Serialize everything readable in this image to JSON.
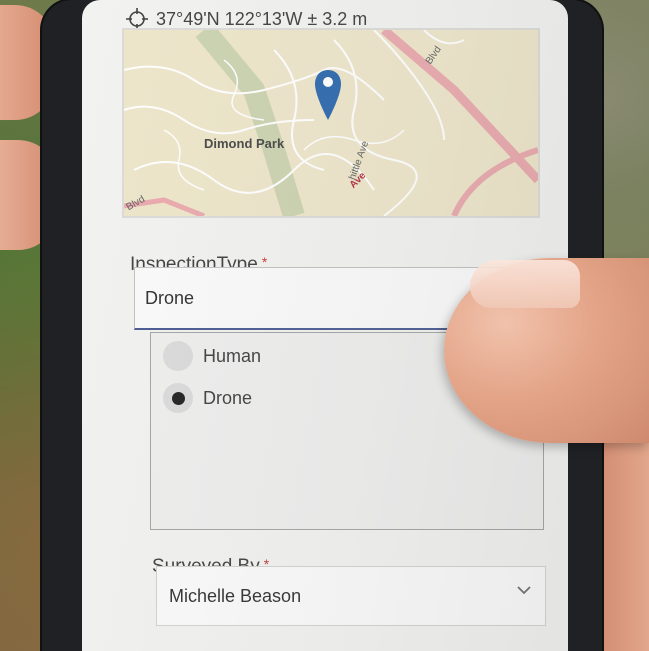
{
  "location": {
    "icon": "crosshair-icon",
    "text": "37°49'N 122°13'W ± 3.2 m"
  },
  "map": {
    "marker_icon": "map-pin-icon",
    "labels": {
      "park": "Dimond Park",
      "blvd": "Blvd",
      "ave_road": "Ave",
      "whittle": "hittle Ave",
      "edge": "Blvd"
    }
  },
  "inspection": {
    "label": "InspectionType",
    "required_mark": "*",
    "value": "Drone",
    "options": [
      {
        "label": "Human",
        "selected": false
      },
      {
        "label": "Drone",
        "selected": true
      }
    ],
    "accent_color": "#3f4f8a"
  },
  "surveyed_by": {
    "label": "Surveyed By",
    "required_mark": "*",
    "value": "Michelle Beason",
    "icon": "chevron-down-icon"
  }
}
